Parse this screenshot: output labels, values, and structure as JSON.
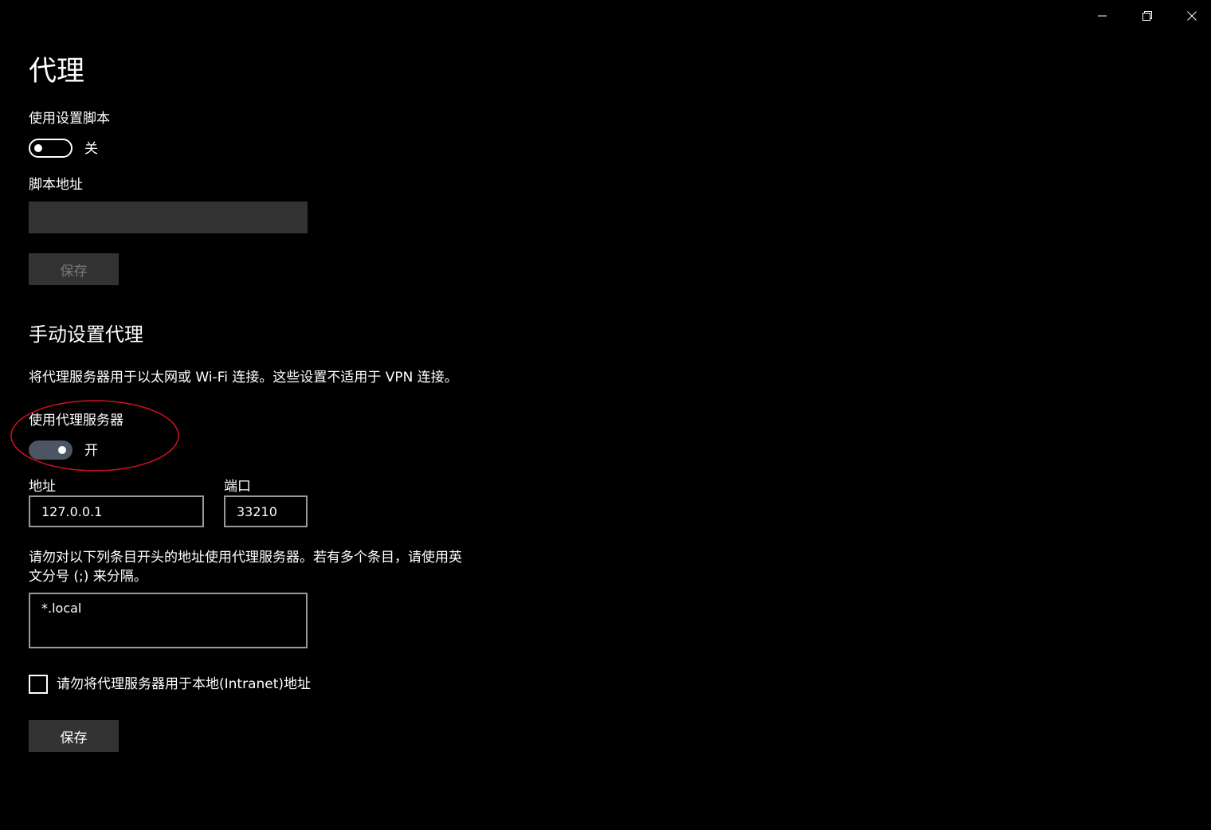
{
  "window": {
    "controls": {
      "minimize_icon": "minimize-icon",
      "maximize_icon": "restore-icon",
      "close_icon": "close-icon"
    }
  },
  "page": {
    "title": "代理"
  },
  "auto_setup": {
    "script_toggle_label": "使用设置脚本",
    "script_toggle_state": "关",
    "script_toggle_on": false,
    "script_address_label": "脚本地址",
    "script_address_value": "",
    "save_label": "保存"
  },
  "manual_setup": {
    "section_title": "手动设置代理",
    "description": "将代理服务器用于以太网或 Wi-Fi 连接。这些设置不适用于 VPN 连接。",
    "use_proxy_label": "使用代理服务器",
    "use_proxy_state": "开",
    "use_proxy_on": true,
    "address_label": "地址",
    "address_value": "127.0.0.1",
    "port_label": "端口",
    "port_value": "33210",
    "exceptions_desc_line1": "请勿对以下列条目开头的地址使用代理服务器。若有多个条目，请使用英",
    "exceptions_desc_line2": "文分号 (;) 来分隔。",
    "exceptions_value": "*.local",
    "bypass_local_label": "请勿将代理服务器用于本地(Intranet)地址",
    "bypass_local_checked": false,
    "save_label": "保存"
  },
  "colors": {
    "background": "#000000",
    "annotation": "#d0121b",
    "toggle_on_track": "#4c5562",
    "button_bg": "#333333"
  }
}
